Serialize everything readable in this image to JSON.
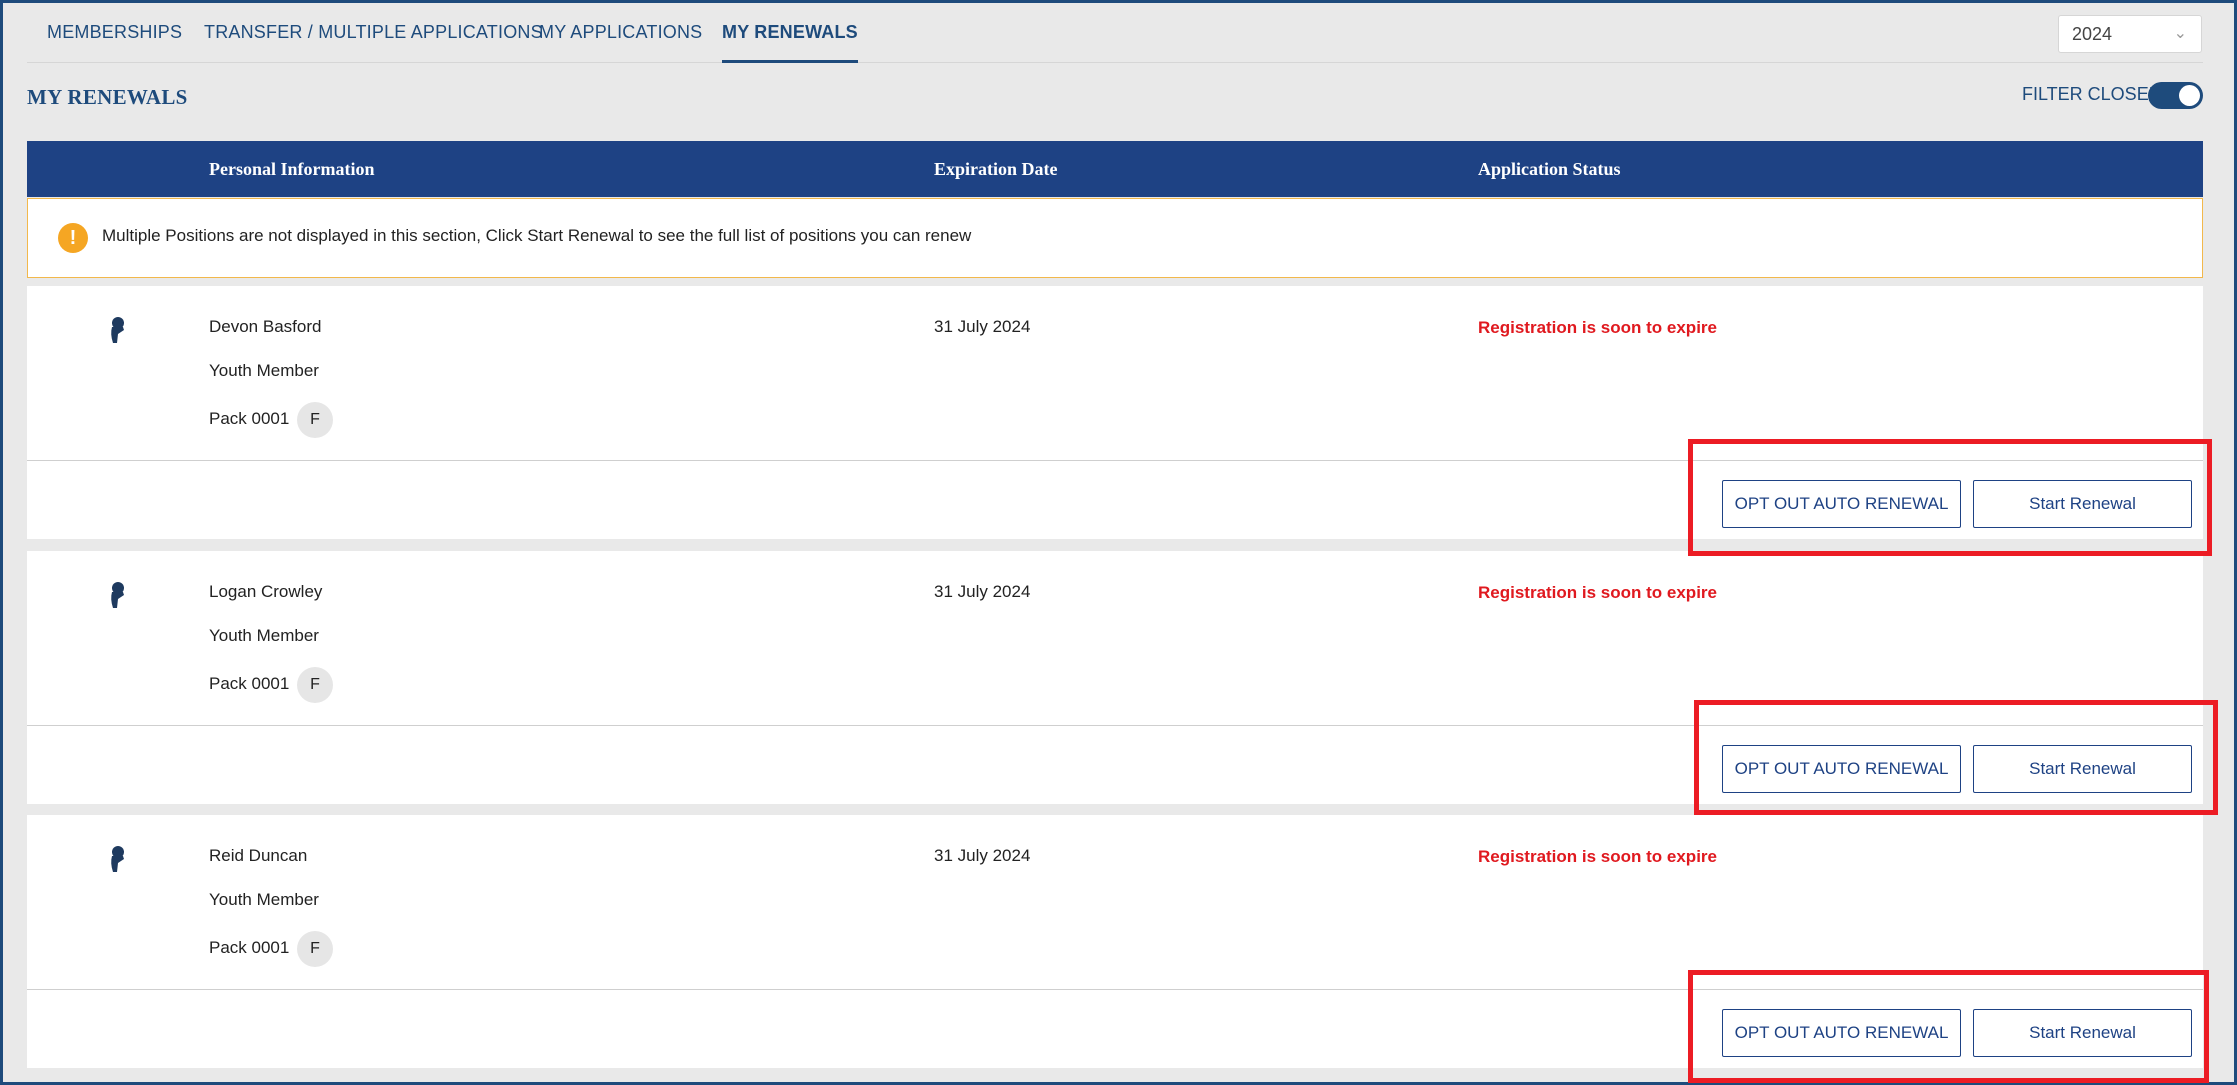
{
  "tabs": [
    {
      "label": "MEMBERSHIPS",
      "active": false
    },
    {
      "label": "TRANSFER / MULTIPLE APPLICATIONS",
      "active": false
    },
    {
      "label": "MY APPLICATIONS",
      "active": false
    },
    {
      "label": "MY RENEWALS",
      "active": true
    }
  ],
  "year_select": {
    "value": "2024",
    "icon": "chevron-down-icon"
  },
  "page_title": "MY RENEWALS",
  "filter": {
    "label": "FILTER CLOSED",
    "on": true
  },
  "table_headers": {
    "personal": "Personal Information",
    "expiration": "Expiration Date",
    "status": "Application Status"
  },
  "notice": {
    "icon": "warning-icon",
    "text": "Multiple Positions are not displayed in this section, Click Start Renewal to see the full list of positions you can renew"
  },
  "renewals": [
    {
      "name": "Devon Basford",
      "role": "Youth Member",
      "unit": "Pack 0001",
      "badge": "F",
      "expiration": "31 July 2024",
      "status": "Registration is soon to expire",
      "opt_out_label": "OPT OUT AUTO RENEWAL",
      "start_label": "Start Renewal"
    },
    {
      "name": "Logan Crowley",
      "role": "Youth Member",
      "unit": "Pack 0001",
      "badge": "F",
      "expiration": "31 July 2024",
      "status": "Registration is soon to expire",
      "opt_out_label": "OPT OUT AUTO RENEWAL",
      "start_label": "Start Renewal"
    },
    {
      "name": "Reid Duncan",
      "role": "Youth Member",
      "unit": "Pack 0001",
      "badge": "F",
      "expiration": "31 July 2024",
      "status": "Registration is soon to expire",
      "opt_out_label": "OPT OUT AUTO RENEWAL",
      "start_label": "Start Renewal"
    }
  ],
  "colors": {
    "brand": "#1e4284",
    "status": "#e0191f",
    "highlight": "#ec1c24",
    "notice_border": "#f2b84b"
  }
}
